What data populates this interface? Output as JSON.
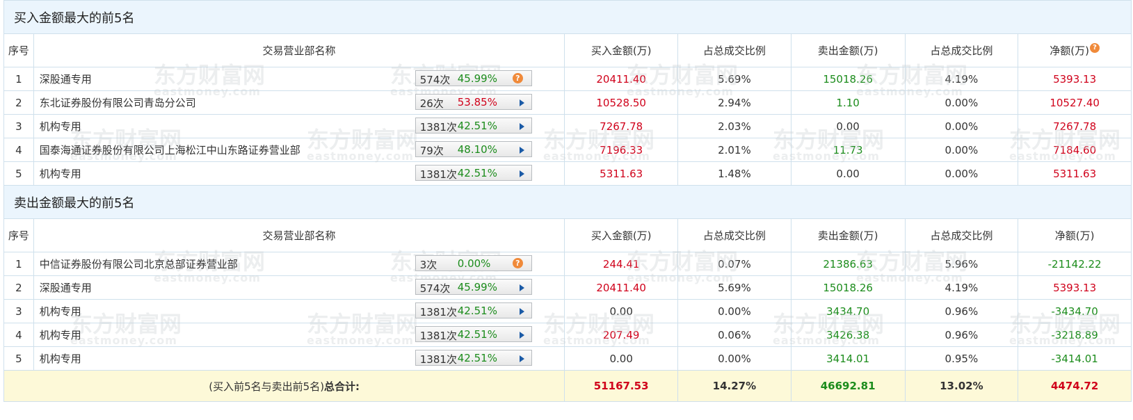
{
  "buy_section": {
    "title": "买入金额最大的前5名",
    "headers": [
      "序号",
      "交易营业部名称",
      "买入金额(万)",
      "占总成交比例",
      "卖出金额(万)",
      "占总成交比例",
      "净额(万)"
    ],
    "rows": [
      {
        "idx": "1",
        "name": "深股通专用",
        "count": "574次",
        "pct": "45.99%",
        "buy": "20411.40",
        "buy_ratio": "5.69%",
        "sell": "15018.26",
        "sell_ratio": "4.19%",
        "net": "5393.13"
      },
      {
        "idx": "2",
        "name": "东北证券股份有限公司青岛分公司",
        "count": "26次",
        "pct": "53.85%",
        "buy": "10528.50",
        "buy_ratio": "2.94%",
        "sell": "1.10",
        "sell_ratio": "0.00%",
        "net": "10527.40"
      },
      {
        "idx": "3",
        "name": "机构专用",
        "count": "1381次",
        "pct": "42.51%",
        "buy": "7267.78",
        "buy_ratio": "2.03%",
        "sell": "0.00",
        "sell_ratio": "0.00%",
        "net": "7267.78"
      },
      {
        "idx": "4",
        "name": "国泰海通证券股份有限公司上海松江中山东路证券营业部",
        "count": "79次",
        "pct": "48.10%",
        "buy": "7196.33",
        "buy_ratio": "2.01%",
        "sell": "11.73",
        "sell_ratio": "0.00%",
        "net": "7184.60"
      },
      {
        "idx": "5",
        "name": "机构专用",
        "count": "1381次",
        "pct": "42.51%",
        "buy": "5311.63",
        "buy_ratio": "1.48%",
        "sell": "0.00",
        "sell_ratio": "0.00%",
        "net": "5311.63"
      }
    ]
  },
  "sell_section": {
    "title": "卖出金额最大的前5名",
    "headers": [
      "序号",
      "交易营业部名称",
      "买入金额(万)",
      "占总成交比例",
      "卖出金额(万)",
      "占总成交比例",
      "净额(万)"
    ],
    "rows": [
      {
        "idx": "1",
        "name": "中信证券股份有限公司北京总部证券营业部",
        "count": "3次",
        "pct": "0.00%",
        "buy": "244.41",
        "buy_ratio": "0.07%",
        "sell": "21386.63",
        "sell_ratio": "5.96%",
        "net": "-21142.22"
      },
      {
        "idx": "2",
        "name": "深股通专用",
        "count": "574次",
        "pct": "45.99%",
        "buy": "20411.40",
        "buy_ratio": "5.69%",
        "sell": "15018.26",
        "sell_ratio": "4.19%",
        "net": "5393.13"
      },
      {
        "idx": "3",
        "name": "机构专用",
        "count": "1381次",
        "pct": "42.51%",
        "buy": "0.00",
        "buy_ratio": "0.00%",
        "sell": "3434.70",
        "sell_ratio": "0.96%",
        "net": "-3434.70"
      },
      {
        "idx": "4",
        "name": "机构专用",
        "count": "1381次",
        "pct": "42.51%",
        "buy": "207.49",
        "buy_ratio": "0.06%",
        "sell": "3426.38",
        "sell_ratio": "0.96%",
        "net": "-3218.89"
      },
      {
        "idx": "5",
        "name": "机构专用",
        "count": "1381次",
        "pct": "42.51%",
        "buy": "0.00",
        "buy_ratio": "0.00%",
        "sell": "3414.01",
        "sell_ratio": "0.95%",
        "net": "-3414.01"
      }
    ]
  },
  "total": {
    "label_prefix": "(买入前5名与卖出前5名)",
    "label_bold": "总合计:",
    "buy": "51167.53",
    "buy_ratio": "14.27%",
    "sell": "46692.81",
    "sell_ratio": "13.02%",
    "net": "4474.72"
  },
  "watermark": {
    "cn": "东方财富网",
    "en": "eastmoney.com"
  },
  "help_glyph": "?",
  "colors": {
    "red": "#d0021b",
    "green": "#1c8c1c",
    "section_bg": "#ebf5fd",
    "total_bg": "#fdf9d8",
    "help_icon": "#f08a3a",
    "arrow": "#1a5aa6"
  }
}
